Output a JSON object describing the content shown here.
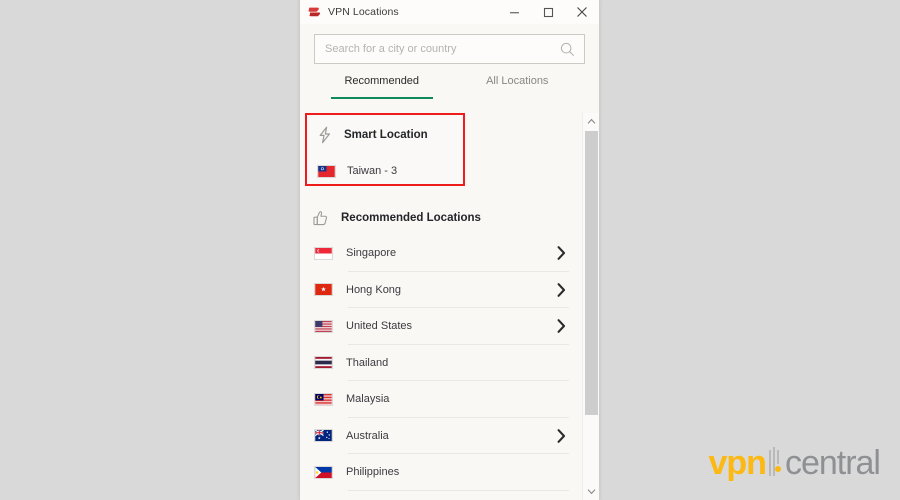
{
  "window": {
    "title": "VPN Locations",
    "logo_icon": "expressvpn-logo-icon",
    "controls": [
      {
        "name": "minimize",
        "label": "–",
        "icon": "minimize-icon"
      },
      {
        "name": "maximize",
        "label": "□",
        "icon": "maximize-icon"
      },
      {
        "name": "close",
        "label": "✕",
        "icon": "close-icon"
      }
    ]
  },
  "search": {
    "placeholder": "Search for a city or country",
    "value": "",
    "icon": "search-icon"
  },
  "tabs": [
    {
      "label": "Recommended",
      "active": true
    },
    {
      "label": "All Locations",
      "active": false
    }
  ],
  "smart_location": {
    "icon": "lightning-bolt-icon",
    "title": "Smart Location",
    "entry": {
      "flag": "taiwan-flag-icon",
      "label": "Taiwan - 3"
    },
    "highlight_color": "#ef1c1c"
  },
  "recommended": {
    "icon": "thumbs-up-icon",
    "title": "Recommended Locations",
    "items": [
      {
        "flag": "singapore-flag-icon",
        "name": "Singapore",
        "expandable": true
      },
      {
        "flag": "hongkong-flag-icon",
        "name": "Hong Kong",
        "expandable": true
      },
      {
        "flag": "unitedstates-flag-icon",
        "name": "United States",
        "expandable": true
      },
      {
        "flag": "thailand-flag-icon",
        "name": "Thailand",
        "expandable": false
      },
      {
        "flag": "malaysia-flag-icon",
        "name": "Malaysia",
        "expandable": false
      },
      {
        "flag": "australia-flag-icon",
        "name": "Australia",
        "expandable": true
      },
      {
        "flag": "philippines-flag-icon",
        "name": "Philippines",
        "expandable": false
      }
    ]
  },
  "scrollbar": {
    "up_icon": "chevron-up-icon",
    "down_icon": "chevron-down-icon"
  },
  "watermark": {
    "primary": "vpn",
    "secondary": "central",
    "primary_color": "#fcb813",
    "secondary_color": "#8f9093"
  },
  "colors": {
    "desktop_background": "#d9d9d9",
    "panel_background": "#faf8f5",
    "tab_accent": "#0e8a5f",
    "highlight_outline": "#ef1c1c"
  }
}
